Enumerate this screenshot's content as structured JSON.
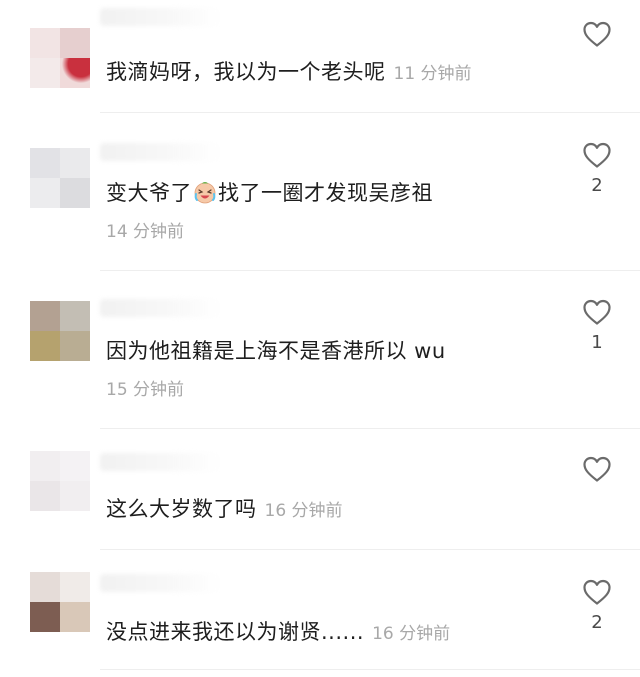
{
  "comments": [
    {
      "text": "我滴妈呀，我以为一个老头呢",
      "time": "11 分钟前",
      "likes": "",
      "avatar_colors": [
        "#f2e4e4",
        "#e9d6d6",
        "#f3eaea",
        "#c9303e"
      ]
    },
    {
      "text_before": "变大爷了",
      "emoji": "crying-laughing-face-emoji",
      "text_after": "找了一圈才发现吴彦祖",
      "time": "14 分钟前",
      "likes": "2",
      "avatar_colors": [
        "#e2e2e6",
        "#eaeaec",
        "#ececee",
        "#d9d9dc"
      ]
    },
    {
      "text": "因为他祖籍是上海不是香港所以 wu",
      "time": "15 分钟前",
      "likes": "1",
      "avatar_colors": [
        "#b3a192",
        "#c3beb4",
        "#b5a26e",
        "#b9ad93"
      ]
    },
    {
      "text": "这么大岁数了吗",
      "time": "16 分钟前",
      "likes": "",
      "avatar_colors": [
        "#f1eef0",
        "#f2f0f2",
        "#eae6e8",
        "#f1eef0"
      ]
    },
    {
      "text": "没点进来我还以为谢贤......",
      "time": "16 分钟前",
      "likes": "2",
      "avatar_colors": [
        "#e5dcd8",
        "#f0ebe8",
        "#7d5d52",
        "#d9c8b8"
      ]
    }
  ]
}
